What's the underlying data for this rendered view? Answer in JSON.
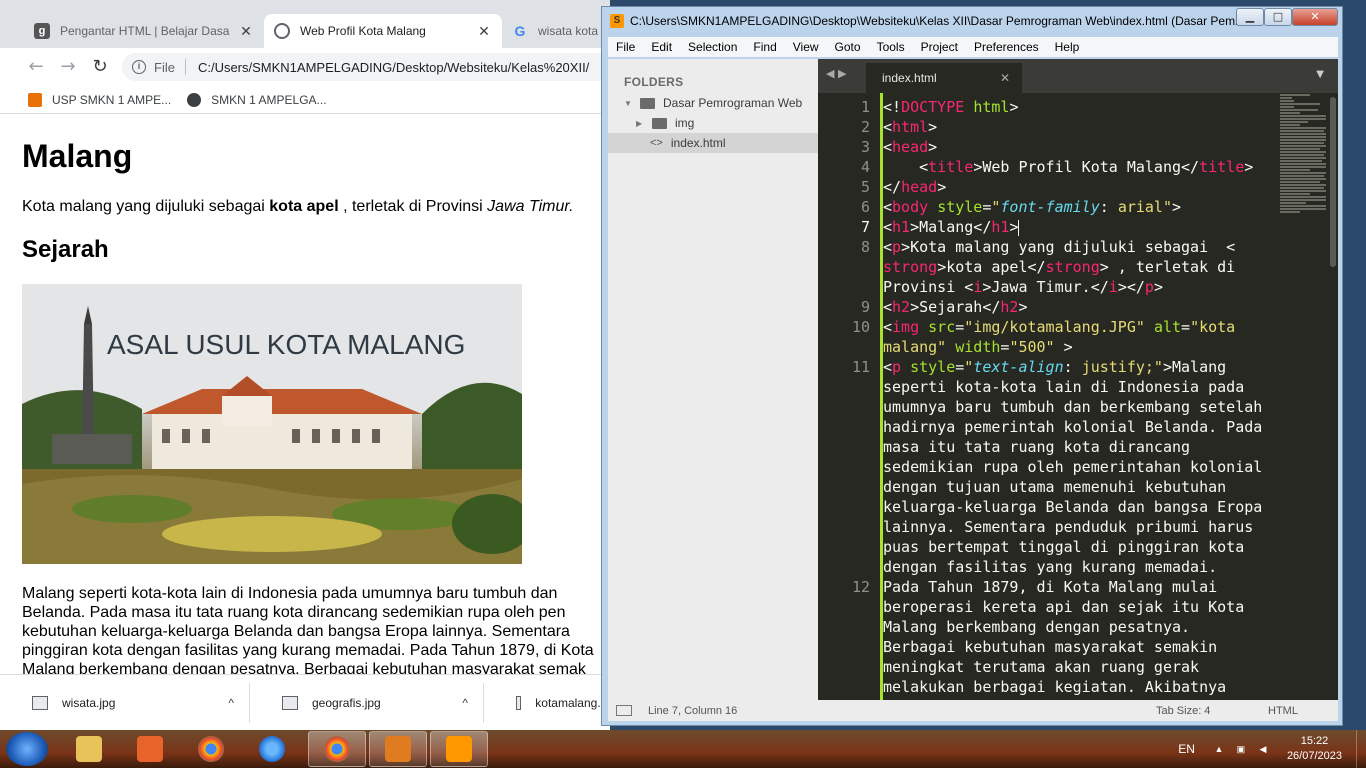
{
  "browser": {
    "tabs": [
      {
        "title": "Pengantar HTML | Belajar Dasar H",
        "close": "✕"
      },
      {
        "title": "Web Profil Kota Malang",
        "close": "✕"
      },
      {
        "title": "wisata kota"
      }
    ],
    "nav": {
      "back": "←",
      "forward": "→",
      "reload": "↻"
    },
    "address": {
      "info": "i",
      "label": "File",
      "url": "C:/Users/SMKN1AMPELGADING/Desktop/Websiteku/Kelas%20XII/"
    },
    "bookmarks": [
      "USP SMKN 1 AMPE...",
      "SMKN 1 AMPELGA..."
    ],
    "page": {
      "heading": "Malang",
      "intro_before": "Kota malang yang dijuluki sebagai ",
      "intro_bold": "kota apel",
      "intro_mid": " , terletak di Provinsi ",
      "intro_italic": "Jawa Timur.",
      "subheading": "Sejarah",
      "image_caption": "ASAL USUL KOTA MALANG",
      "paragraph_lines": [
        "Malang seperti kota-kota lain di Indonesia pada umumnya baru tumbuh dan",
        "Belanda. Pada masa itu tata ruang kota dirancang sedemikian rupa oleh pen",
        "kebutuhan keluarga-keluarga Belanda dan bangsa Eropa lainnya. Sementara",
        "pinggiran kota dengan fasilitas yang kurang memadai. Pada Tahun 1879, di Kota",
        "Malang berkembang dengan pesatnya. Berbagai kebutuhan masyarakat semak"
      ]
    },
    "downloads": [
      {
        "name": "wisata.jpg",
        "chevron": "^"
      },
      {
        "name": "geografis.jpg",
        "chevron": "^"
      },
      {
        "name": "kotamalang.JPG"
      }
    ]
  },
  "sublime": {
    "title": "C:\\Users\\SMKN1AMPELGADING\\Desktop\\Websiteku\\Kelas XII\\Dasar Pemrograman Web\\index.html (Dasar Pemrograman Web) - Sublime Text (UNREGISTERED)",
    "window_buttons": {
      "minimize": "▁",
      "maximize": "□",
      "close": "✕"
    },
    "menu": [
      "File",
      "Edit",
      "Selection",
      "Find",
      "View",
      "Goto",
      "Tools",
      "Project",
      "Preferences",
      "Help"
    ],
    "sidebar": {
      "header": "FOLDERS",
      "root": "Dasar Pemrograman Web",
      "folder": "img",
      "file": "index.html",
      "file_glyph": "<>"
    },
    "tab": {
      "name": "index.html",
      "close": "✕"
    },
    "tab_nav": "◀ ▶",
    "tab_dropdown": "▼",
    "line_numbers": [
      "1",
      "2",
      "3",
      "4",
      "5",
      "6",
      "7",
      "8",
      "9",
      "10",
      "11",
      "12"
    ],
    "status": {
      "position": "Line 7, Column 16",
      "tab_size": "Tab Size: 4",
      "syntax": "HTML"
    }
  },
  "taskbar": {
    "language": "EN",
    "time": "15:22",
    "date": "26/07/2023"
  },
  "colors": {
    "editor_bg": "#272822",
    "tag": "#f92672",
    "attr": "#a6e22e",
    "string": "#e6db74",
    "property": "#66d9ef"
  }
}
